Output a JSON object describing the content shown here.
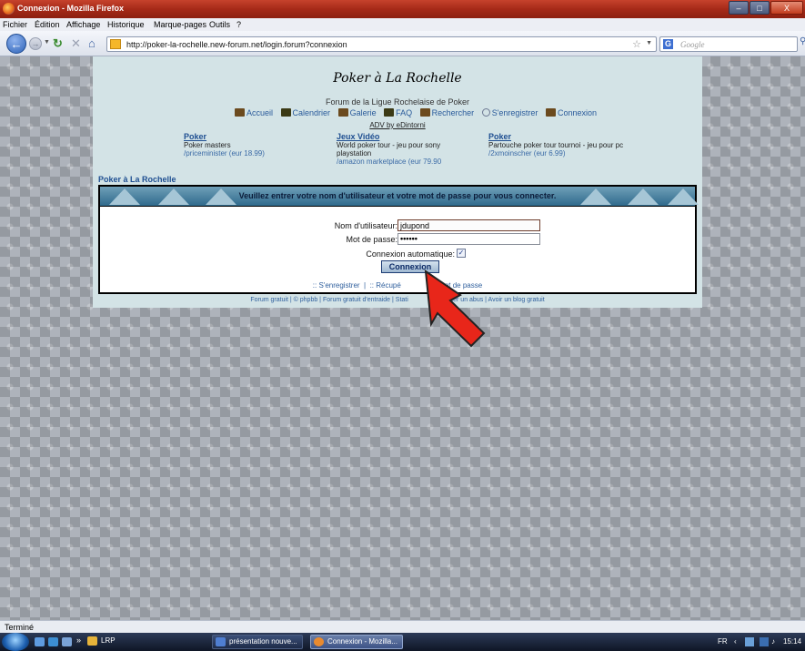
{
  "window": {
    "title": "Connexion - Mozilla Firefox",
    "min_glyph": "–",
    "max_glyph": "□",
    "close_glyph": "X"
  },
  "menu": [
    "Fichier",
    "Édition",
    "Affichage",
    "Historique",
    "Marque-pages",
    "Outils",
    "?"
  ],
  "toolbar": {
    "url": "http://poker-la-rochelle.new-forum.net/login.forum?connexion",
    "search_placeholder": "Google",
    "search_engine_glyph": "G"
  },
  "forum": {
    "title": "Poker à La Rochelle",
    "description": "Forum de la Ligue Rochelaise de Poker",
    "nav_links": [
      "Accueil",
      "Calendrier",
      "Galerie",
      "FAQ",
      "Rechercher",
      "S'enregistrer",
      "Connexion"
    ],
    "adv": "ADV by eDintorni",
    "ads": [
      {
        "heading": "Poker",
        "line1": "Poker masters",
        "line2": "",
        "source": "/priceminister (eur 18.99)"
      },
      {
        "heading": "Jeux Vidéo",
        "line1": "World poker tour - jeu pour sony",
        "line2": "playstation",
        "source": "/amazon marketplace (eur 79.90"
      },
      {
        "heading": "Poker",
        "line1": "Partouche poker tour tournoi - jeu pour pc",
        "line2": "",
        "source": "/2xmoinscher (eur 6.99)"
      }
    ],
    "breadcrumb": "Poker à La Rochelle",
    "login": {
      "header": "Veuillez entrer votre nom d'utilisateur et votre mot de passe pour vous connecter.",
      "username_label": "Nom d'utilisateur:",
      "username_value": "jdupond",
      "password_label": "Mot de passe:",
      "password_value": "••••••",
      "autologin_label": "Connexion automatique:",
      "autologin_checked": true,
      "submit_label": "Connexion",
      "register_link": ":: S'enregistrer",
      "separator": "|",
      "recover_link_part1": ":: Récupé",
      "recover_link_part2": "ot de passe"
    },
    "footer": [
      "Forum gratuit",
      "© phpbb",
      "Forum gratuit d'entraide",
      "Stati",
      "naler un abus",
      "Avoir un blog gratuit"
    ]
  },
  "status": "Terminé",
  "taskbar": {
    "quicklaunch_more": "»",
    "tasks": [
      {
        "label": "LRP",
        "active": false
      },
      {
        "label": "présentation nouve...",
        "active": false
      },
      {
        "label": "Connexion - Mozilla...",
        "active": true
      }
    ],
    "lang": "FR",
    "clock": "15:14"
  },
  "colors": {
    "accent_red": "#e8261a",
    "forum_bg": "#d3e3e6",
    "link_blue": "#1f4f91"
  }
}
